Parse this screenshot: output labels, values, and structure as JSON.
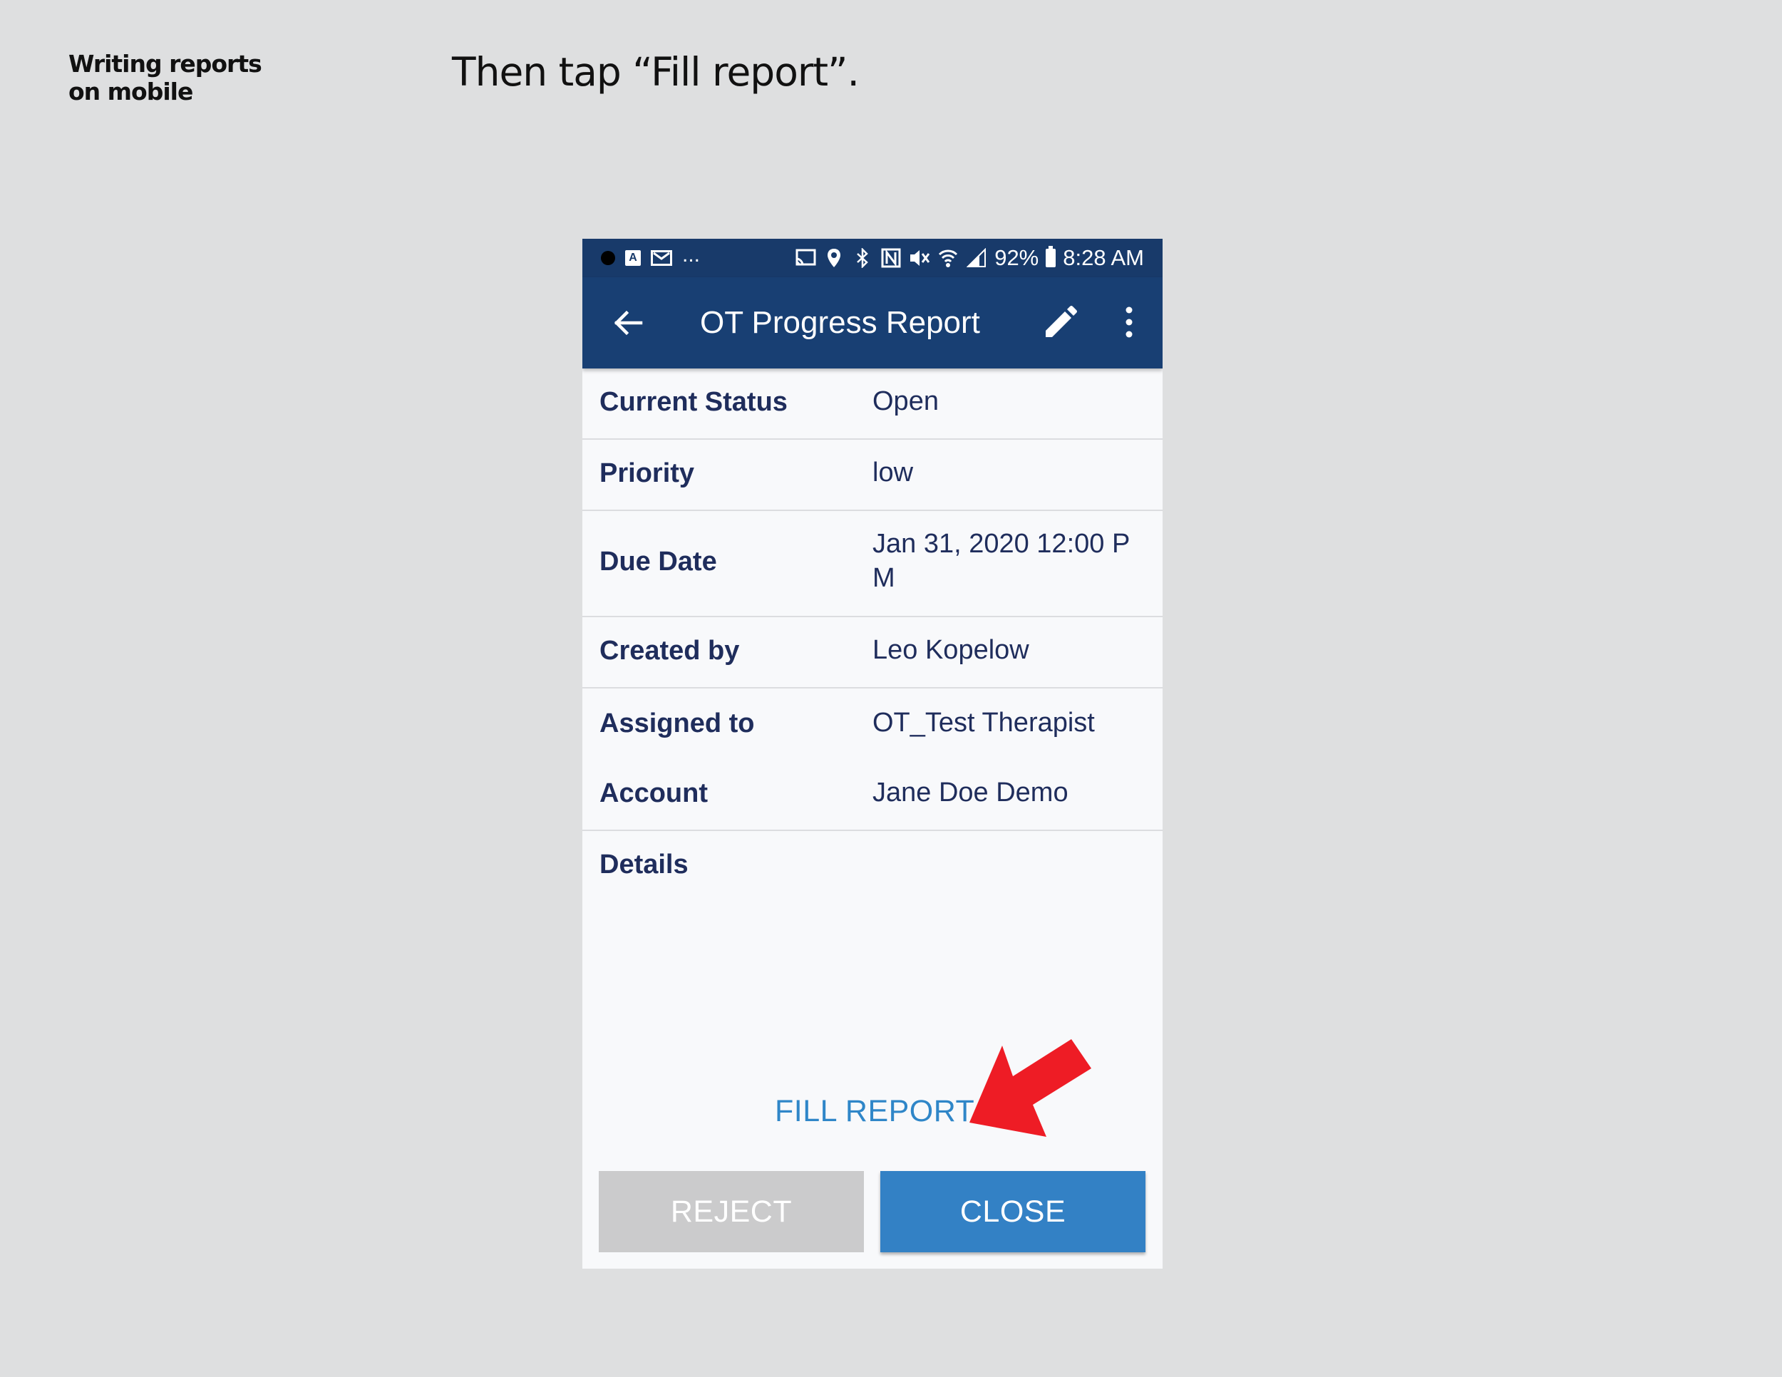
{
  "slide": {
    "label_line1": "Writing reports",
    "label_line2": "on mobile",
    "heading": "Then tap “Fill report”."
  },
  "status_bar": {
    "left_box": "A",
    "more": "...",
    "battery": "92%",
    "time": "8:28 AM"
  },
  "app_bar": {
    "title": "OT Progress Report"
  },
  "details": [
    {
      "label": "Current Status",
      "value": "Open"
    },
    {
      "label": "Priority",
      "value": "low"
    },
    {
      "label": "Due Date",
      "value": "Jan 31, 2020 12:00 PM"
    },
    {
      "label": "Created by",
      "value": "Leo Kopelow"
    },
    {
      "label": "Assigned to",
      "value": "OT_Test Therapist"
    },
    {
      "label": "Account",
      "value": "Jane Doe Demo"
    },
    {
      "label": "Details",
      "value": ""
    }
  ],
  "actions": {
    "fill_report": "FILL REPORT",
    "reject": "REJECT",
    "close": "CLOSE"
  },
  "colors": {
    "app_bar": "#183f73",
    "status_bar": "#183a6a",
    "link": "#2f86c8",
    "primary_button": "#3381c5",
    "disabled_button": "#cbcbcc",
    "arrow": "#ee1c25"
  }
}
